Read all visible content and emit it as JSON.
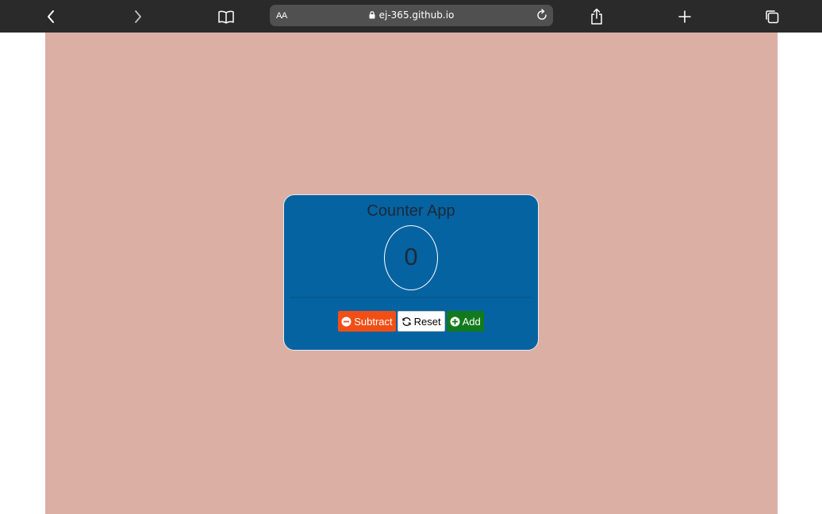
{
  "browser": {
    "address_bar": {
      "reader_label": "AA",
      "url": "ej-365.github.io"
    },
    "toolbar_icons": [
      "back-icon",
      "forward-icon",
      "bookmarks-icon",
      "share-icon",
      "new-tab-icon",
      "tabs-icon"
    ]
  },
  "app": {
    "title": "Counter App",
    "count": "0",
    "buttons": {
      "subtract": "Subtract",
      "reset": "Reset",
      "add": "Add"
    }
  },
  "colors": {
    "page_background": "#dcafa5",
    "card_background": "#0663a1",
    "subtract": "#f24f16",
    "reset": "#ffffff",
    "add": "#117a1d"
  }
}
